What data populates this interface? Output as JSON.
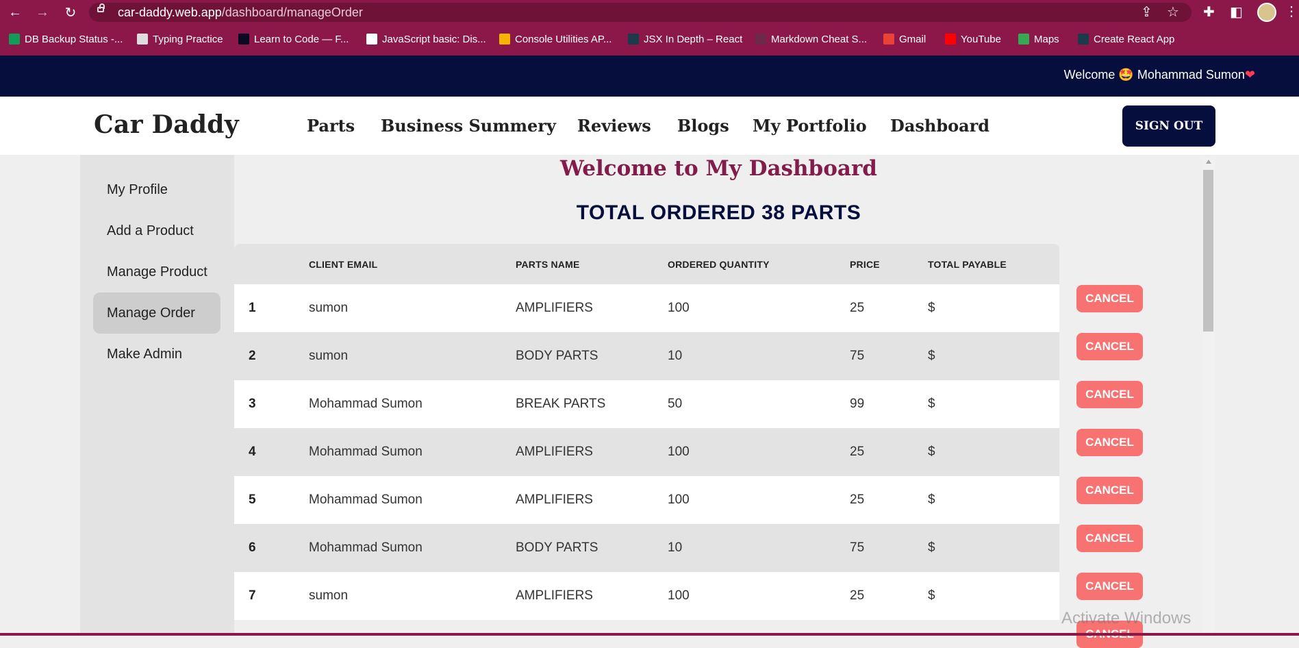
{
  "browser": {
    "url_host": "car-daddy.web.app",
    "url_path": "/dashboard/manageOrder",
    "bookmarks": [
      {
        "label": "DB Backup Status -...",
        "icon": "sheets-icon",
        "color": "#0f9d58"
      },
      {
        "label": "Typing Practice",
        "icon": "keyboard-icon",
        "color": "#dddddd"
      },
      {
        "label": "Learn to Code — F...",
        "icon": "freecodecamp-icon",
        "color": "#0a0a23"
      },
      {
        "label": "JavaScript basic: Dis...",
        "icon": "w3r-icon",
        "color": "#ffffff"
      },
      {
        "label": "Console Utilities AP...",
        "icon": "chrome-icon",
        "color": "#f4b400"
      },
      {
        "label": "JSX In Depth – React",
        "icon": "react-icon",
        "color": "#1b3a4b"
      },
      {
        "label": "Markdown Cheat S...",
        "icon": "markdown-icon",
        "color": "#6b2a4a"
      },
      {
        "label": "Gmail",
        "icon": "gmail-icon",
        "color": "#ea4335"
      },
      {
        "label": "YouTube",
        "icon": "youtube-icon",
        "color": "#ff0000"
      },
      {
        "label": "Maps",
        "icon": "maps-icon",
        "color": "#34a853"
      },
      {
        "label": "Create React App",
        "icon": "react-icon",
        "color": "#1b3a4b"
      }
    ]
  },
  "topbar": {
    "welcome_prefix": "Welcome",
    "emoji": "🤩",
    "user_name": "Mohammad Sumon",
    "heart": "❤"
  },
  "header": {
    "logo": "Car Daddy",
    "nav": [
      "Parts",
      "Business Summery",
      "Reviews",
      "Blogs",
      "My Portfolio",
      "Dashboard"
    ],
    "sign_out": "SIGN OUT"
  },
  "sidebar": {
    "items": [
      {
        "label": "My Profile",
        "active": false
      },
      {
        "label": "Add a Product",
        "active": false
      },
      {
        "label": "Manage Product",
        "active": false
      },
      {
        "label": "Manage Order",
        "active": true
      },
      {
        "label": "Make Admin",
        "active": false
      }
    ]
  },
  "main": {
    "title": "Welcome to My Dashboard",
    "total": "TOTAL ORDERED 38 PARTS",
    "columns": [
      "CLIENT EMAIL",
      "PARTS NAME",
      "ORDERED QUANTITY",
      "PRICE",
      "TOTAL PAYABLE"
    ],
    "rows": [
      {
        "n": "1",
        "email": "sumon",
        "part": "AMPLIFIERS",
        "qty": "100",
        "price": "25",
        "total": "$"
      },
      {
        "n": "2",
        "email": "sumon",
        "part": "BODY PARTS",
        "qty": "10",
        "price": "75",
        "total": "$"
      },
      {
        "n": "3",
        "email": "Mohammad Sumon",
        "part": "BREAK PARTS",
        "qty": "50",
        "price": "99",
        "total": "$"
      },
      {
        "n": "4",
        "email": "Mohammad Sumon",
        "part": "AMPLIFIERS",
        "qty": "100",
        "price": "25",
        "total": "$"
      },
      {
        "n": "5",
        "email": "Mohammad Sumon",
        "part": "AMPLIFIERS",
        "qty": "100",
        "price": "25",
        "total": "$"
      },
      {
        "n": "6",
        "email": "Mohammad Sumon",
        "part": "BODY PARTS",
        "qty": "10",
        "price": "75",
        "total": "$"
      },
      {
        "n": "7",
        "email": "sumon",
        "part": "AMPLIFIERS",
        "qty": "100",
        "price": "25",
        "total": "$"
      }
    ],
    "cancel_label": "CANCEL"
  },
  "watermark": "Activate Windows",
  "colors": {
    "chrome": "#8b1848",
    "navy": "#050e3c",
    "title": "#821c4a",
    "cancel": "#f87272"
  }
}
